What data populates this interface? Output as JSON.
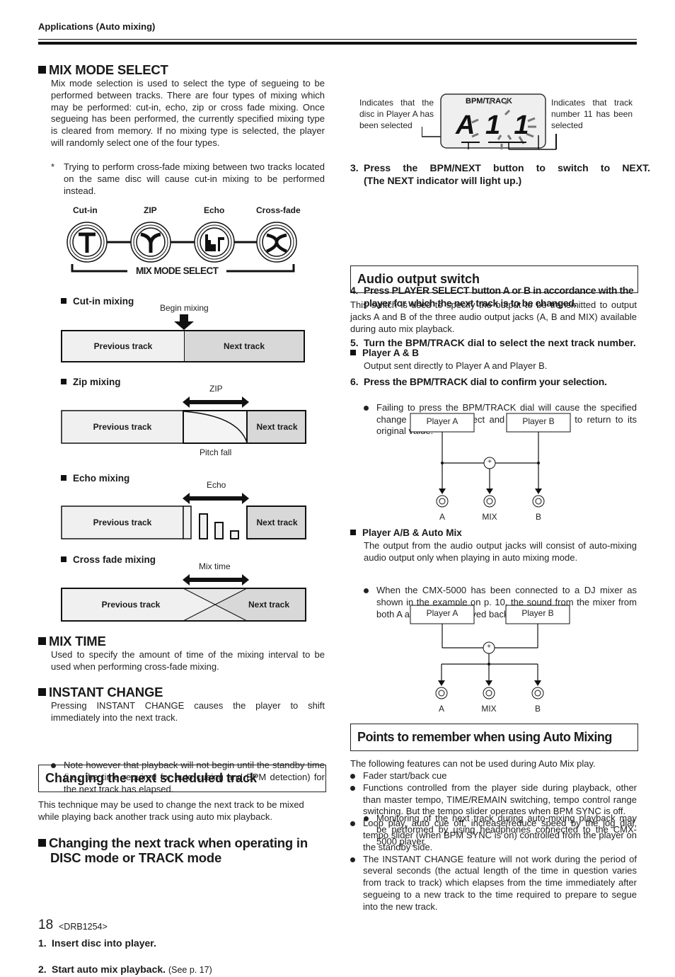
{
  "header": {
    "section": "Applications (Auto mixing)"
  },
  "mix_mode_select": {
    "title": "MIX MODE SELECT",
    "body": "Mix mode selection is used to select the type of segueing to be performed between tracks. There are four types of mixing which may be performed: cut-in, echo, zip or cross fade mixing. Once segueing has been performed, the currently specified mixing type is cleared from memory. If no mixing type is selected, the player will randomly select one of the four types.",
    "note_marker": "*",
    "note": "Trying to perform cross-fade mixing between two tracks located on the same disc will cause cut-in mixing to be performed instead.",
    "buttons": [
      {
        "label": "Cut-in",
        "icon": "cut-in-icon"
      },
      {
        "label": "ZIP",
        "icon": "zip-icon"
      },
      {
        "label": "Echo",
        "icon": "echo-icon"
      },
      {
        "label": "Cross-fade",
        "icon": "cross-fade-icon"
      }
    ],
    "group_label": "MIX MODE SELECT"
  },
  "diagrams": {
    "cut_in": {
      "title": "Cut-in mixing",
      "marker": "Begin mixing",
      "prev": "Previous track",
      "next": "Next track"
    },
    "zip": {
      "title": "Zip mixing",
      "span": "ZIP",
      "under": "Pitch fall",
      "prev": "Previous track",
      "next": "Next track"
    },
    "echo": {
      "title": "Echo mixing",
      "span": "Echo",
      "prev": "Previous track",
      "next": "Next track"
    },
    "cross_fade": {
      "title": "Cross fade mixing",
      "span": "Mix time",
      "prev": "Previous track",
      "next": "Next track"
    }
  },
  "mix_time": {
    "title": "MIX TIME",
    "body": "Used to specify the amount of time of the mixing interval to be used when performing cross-fade mixing."
  },
  "instant_change": {
    "title": "INSTANT CHANGE",
    "body": "Pressing INSTANT CHANGE causes the player to shift immediately into the next track.",
    "note": "Note however that playback will not begin until the standby time (i.e., the time required for auto cueing and BPM detection) for the next track has elapsed."
  },
  "changing_next": {
    "box_title": "Changing the next scheduled track",
    "body": "This technique may be used to change the next track to be mixed while playing back another track using auto mix playback.",
    "subtitle_line1": "Changing the next track when operating in",
    "subtitle_line2": "DISC mode or TRACK mode",
    "steps": [
      {
        "n": "1.",
        "text": "Insert disc into player.",
        "extra": ""
      },
      {
        "n": "2.",
        "text": "Start auto mix playback.",
        "extra": "(See p. 17)"
      }
    ]
  },
  "right_steps": {
    "step3": {
      "n": "3.",
      "line1": "Press the BPM/NEXT button to switch to NEXT.",
      "line2": "(The NEXT indicator will light up.)"
    },
    "display": {
      "label": "BPM/TRACK",
      "player": "A",
      "track": "11",
      "left_note": "Indicates that the disc in Player A has been selected",
      "right_note": "Indicates that track number 11 has been selected"
    },
    "step4": {
      "n": "4.",
      "text": "Press PLAYER SELECT button A or B in accordance with the player for which the next track is to be changed."
    },
    "step5": {
      "n": "5.",
      "text": "Turn the BPM/TRACK dial to select the next track number."
    },
    "step6": {
      "n": "6.",
      "text": "Press the BPM/TRACK dial to confirm your selection."
    },
    "step6_note": "Failing to press the BPM/TRACK dial will cause the specified change not to take effect and for the display to return to its original value."
  },
  "audio_output": {
    "box_title": "Audio output switch",
    "body": "This switch is used to specify the output to be transmitted to output jacks A and B of the three audio output jacks (A, B and MIX) available during auto mix playback.",
    "ab": {
      "title": "Player A & B",
      "body": "Output sent directly to Player A and Player B.",
      "note": "When the CMX-5000 has been connected to a DJ mixer as shown in the example on p. 10, the sound from the mixer from both A and B will be played back."
    },
    "auto": {
      "title": "Player A/B & Auto Mix",
      "body": "The output from the audio output jacks will consist of auto-mixing audio output only when playing in auto mixing mode.",
      "note": "Monitoring of the next track during auto-mixing playback may be performed by using headphones connected to the CMX-5000 player."
    },
    "diagram": {
      "player_a": "Player A",
      "player_b": "Player B",
      "jack_a": "A",
      "jack_mix": "MIX",
      "jack_b": "B",
      "sum": "+"
    }
  },
  "points": {
    "box_title": "Points to remember when using Auto Mixing",
    "intro": "The following features can not be used during Auto Mix play.",
    "items": [
      "Fader start/back cue",
      "Functions controlled from the player side during playback, other than master tempo, TIME/REMAIN switching, tempo control range switching. But the tempo slider operates when BPM SYNC is off.",
      "Loop play, auto cue off, increase/reduce speed by the jog dial, tempo slider (when BPM SYNC is on) controlled from the player on the standby side.",
      "The INSTANT CHANGE feature will not work during the period of several seconds (the actual length of the time in question varies from track to track) which elapses from the time immediately after segueing to a new track to the time required to prepare to segue into the new track."
    ]
  },
  "footer": {
    "page": "18",
    "code": "<DRB1254>"
  }
}
